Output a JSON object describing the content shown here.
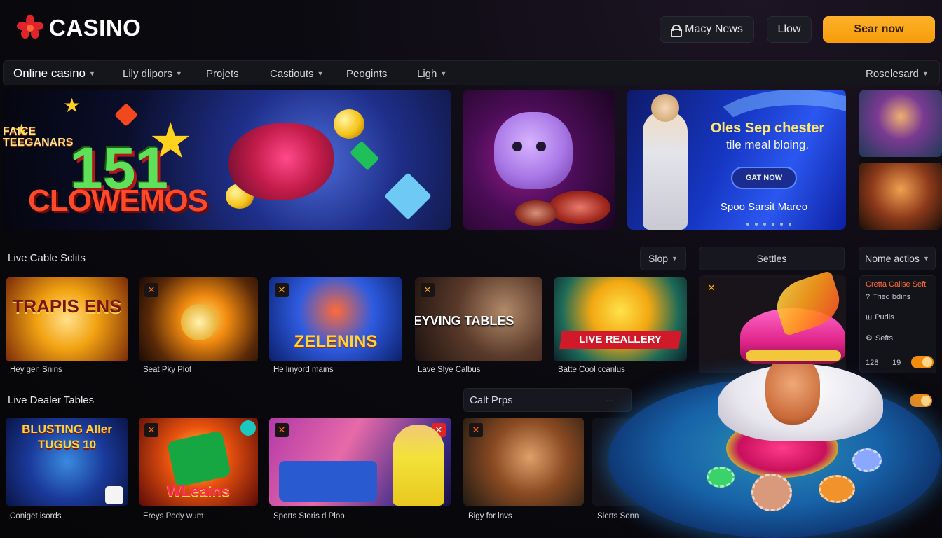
{
  "header": {
    "logo_text": "CASINO",
    "btn_news": "Macy News",
    "btn_low": "Llow",
    "btn_cta": "Sear now"
  },
  "nav": {
    "items": [
      "Online casino",
      "Lily dlipors",
      "Projets",
      "Castiouts",
      "Peogints",
      "Ligh"
    ],
    "right": "Roselesard"
  },
  "banners": {
    "b1_num": "151",
    "b1_word": "CLOWEMOS",
    "b3_title": "Oles Sep chester",
    "b3_sub": "tile meal bloing.",
    "b3_button": "GAT NOW",
    "b3_foot": "Spoo Sarsit Mareo",
    "b4_text": "FAICE TEEGANARS"
  },
  "section1": {
    "title": "Live Cable Sclits",
    "ctrl_sort": "Slop",
    "ctrl_settles": "Settles",
    "ctrl_actions": "Nome actios",
    "cards": [
      {
        "label": "Hey gen Snins",
        "title": "TRAPIS ENS"
      },
      {
        "label": "Seat Pky Plot",
        "title": ""
      },
      {
        "label": "He linyord mains",
        "title": "ZELENINS"
      },
      {
        "label": "Lave Slye Calbus",
        "title": "REYVING TABLES"
      },
      {
        "label": "Batte Cool ccanlus",
        "title": "LIVE REALLERY"
      }
    ]
  },
  "section2": {
    "title": "Live Dealer Tables",
    "calt_props": "Calt Prps",
    "calt_arrows": "--",
    "cards": [
      {
        "label": "Coniget isords",
        "title": "BLUSTING Aller TUGUS 10"
      },
      {
        "label": "Ereys Pody wum",
        "title": "WLeains"
      },
      {
        "label": "Sports Storis d Plop",
        "title": ""
      },
      {
        "label": "Bigy for lnvs",
        "title": ""
      },
      {
        "label": "Slerts Sonn",
        "title": ""
      }
    ]
  },
  "right_panel": {
    "title": "Cretta Calise Seft",
    "items": [
      "Tried bdins",
      "Pudis",
      "Sefts"
    ],
    "stat_a": "128",
    "stat_b": "19"
  },
  "colors": {
    "accent": "#f59d0a",
    "background": "#060608",
    "panel": "#15161c"
  }
}
